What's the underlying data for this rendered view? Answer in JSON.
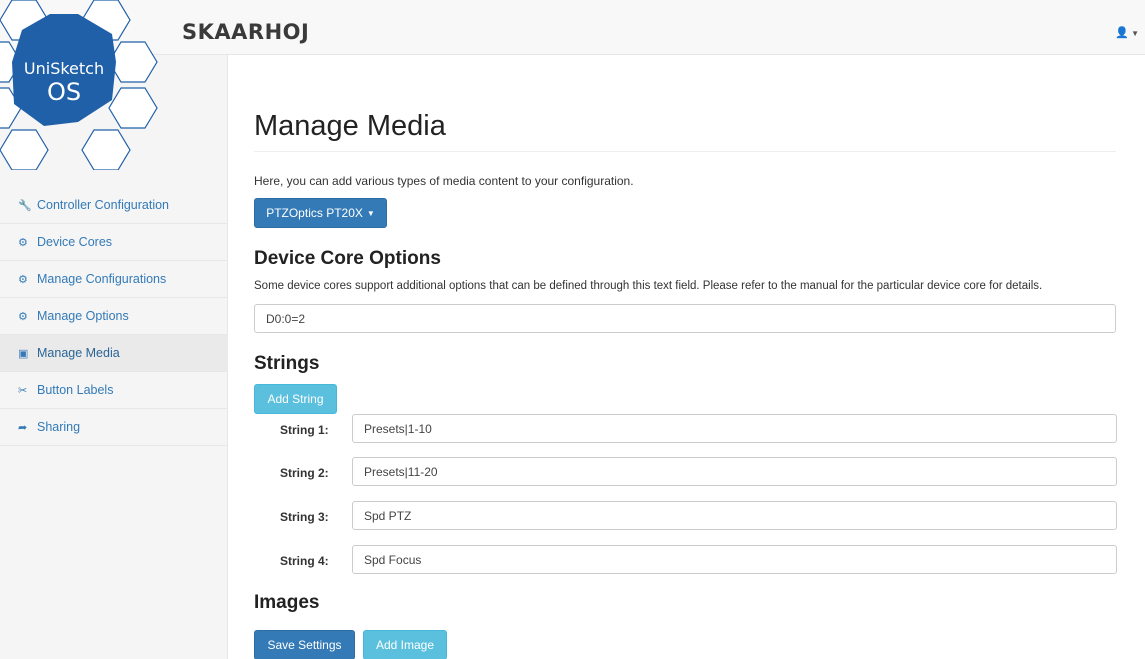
{
  "header": {
    "brand": "SKAARHOJ",
    "user_icon": "user-icon"
  },
  "logo": {
    "line1": "UniSketch",
    "line2": "OS"
  },
  "sidebar": {
    "items": [
      {
        "label": "Controller Configuration",
        "icon": "wrench-icon",
        "glyph": "🔧"
      },
      {
        "label": "Device Cores",
        "icon": "cogs-icon",
        "glyph": "⚙"
      },
      {
        "label": "Manage Configurations",
        "icon": "cogs-icon",
        "glyph": "⚙"
      },
      {
        "label": "Manage Options",
        "icon": "cogs-icon",
        "glyph": "⚙"
      },
      {
        "label": "Manage Media",
        "icon": "picture-icon",
        "glyph": "▣"
      },
      {
        "label": "Button Labels",
        "icon": "scissors-icon",
        "glyph": "✂"
      },
      {
        "label": "Sharing",
        "icon": "share-icon",
        "glyph": "➦"
      }
    ],
    "active_index": 4
  },
  "main": {
    "title": "Manage Media",
    "intro": "Here, you can add various types of media content to your configuration.",
    "device_button": "PTZOptics PT20X",
    "core_options": {
      "heading": "Device Core Options",
      "help": "Some device cores support additional options that can be defined through this text field. Please refer to the manual for the particular device core for details.",
      "value": "D0:0=2"
    },
    "strings": {
      "heading": "Strings",
      "add_label": "Add String",
      "items": [
        {
          "label": "String 1:",
          "value": "Presets|1-10"
        },
        {
          "label": "String 2:",
          "value": "Presets|11-20"
        },
        {
          "label": "String 3:",
          "value": "Spd PTZ"
        },
        {
          "label": "String 4:",
          "value": "Spd Focus"
        }
      ]
    },
    "images": {
      "heading": "Images"
    },
    "save_label": "Save Settings",
    "add_image_label": "Add Image"
  },
  "colors": {
    "primary": "#337ab7",
    "info": "#5bc0de",
    "logo_blue": "#2060a8"
  }
}
